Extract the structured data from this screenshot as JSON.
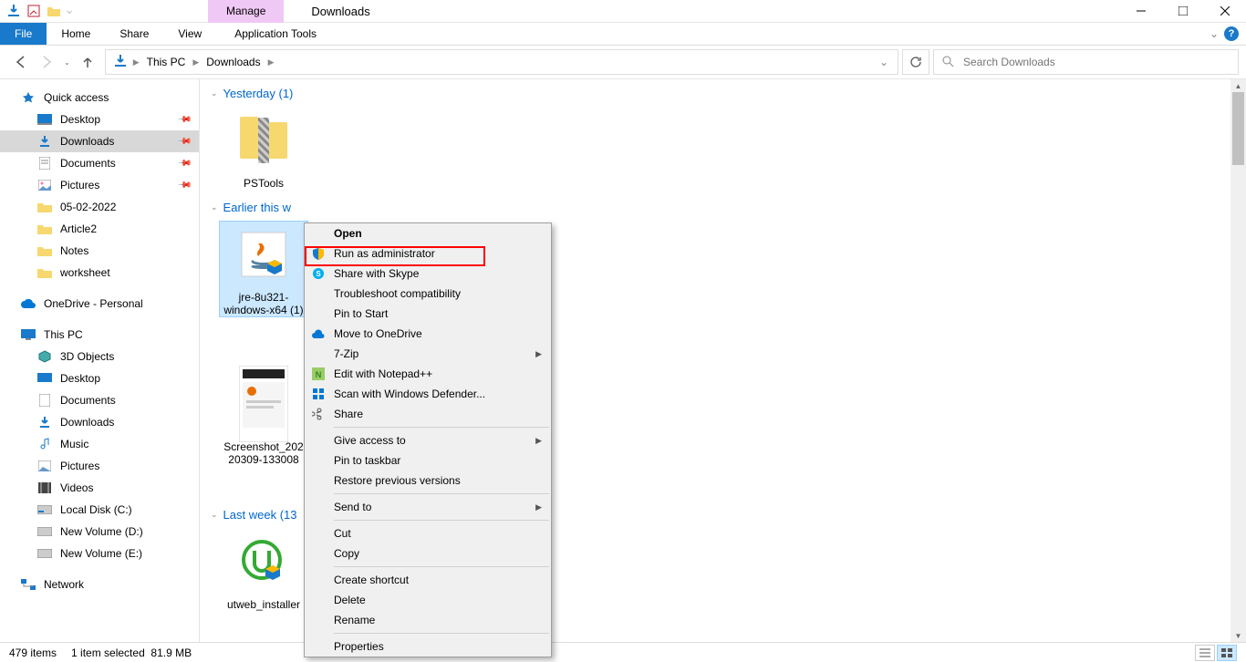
{
  "titlebar": {
    "contextual_tab": "Manage",
    "window_title": "Downloads"
  },
  "ribbon": {
    "file": "File",
    "home": "Home",
    "share": "Share",
    "view": "View",
    "app_tools": "Application Tools"
  },
  "breadcrumb": {
    "root": "This PC",
    "current": "Downloads"
  },
  "search": {
    "placeholder": "Search Downloads"
  },
  "sidebar": {
    "quick_access": "Quick access",
    "qa_items": [
      {
        "label": "Desktop",
        "icon": "desktop"
      },
      {
        "label": "Downloads",
        "icon": "downloads",
        "active": true
      },
      {
        "label": "Documents",
        "icon": "documents"
      },
      {
        "label": "Pictures",
        "icon": "pictures"
      },
      {
        "label": "05-02-2022",
        "icon": "folder"
      },
      {
        "label": "Article2",
        "icon": "folder"
      },
      {
        "label": "Notes",
        "icon": "folder"
      },
      {
        "label": "worksheet",
        "icon": "folder"
      }
    ],
    "onedrive": "OneDrive - Personal",
    "this_pc": "This PC",
    "pc_items": [
      {
        "label": "3D Objects"
      },
      {
        "label": "Desktop"
      },
      {
        "label": "Documents"
      },
      {
        "label": "Downloads"
      },
      {
        "label": "Music"
      },
      {
        "label": "Pictures"
      },
      {
        "label": "Videos"
      },
      {
        "label": "Local Disk (C:)"
      },
      {
        "label": "New Volume (D:)"
      },
      {
        "label": "New Volume (E:)"
      }
    ],
    "network": "Network"
  },
  "groups": {
    "yesterday": {
      "label": "Yesterday (1)",
      "items": [
        {
          "name": "PSTools",
          "type": "zipfolder"
        }
      ]
    },
    "earlier": {
      "label": "Earlier this w",
      "items": [
        {
          "name": "jre-8u321-windows-x64 (1)",
          "type": "exe-java",
          "selected": true
        },
        {
          "name": "Screenshot_20220309-133008",
          "type": "image"
        }
      ]
    },
    "lastweek": {
      "label": "Last week (13",
      "items": [
        {
          "name": "utweb_installer",
          "type": "exe-ut"
        }
      ]
    }
  },
  "context_menu": {
    "open": "Open",
    "run_admin": "Run as administrator",
    "share_skype": "Share with Skype",
    "troubleshoot": "Troubleshoot compatibility",
    "pin_start": "Pin to Start",
    "move_onedrive": "Move to OneDrive",
    "sevenzip": "7-Zip",
    "edit_np": "Edit with Notepad++",
    "defender": "Scan with Windows Defender...",
    "share": "Share",
    "give_access": "Give access to",
    "pin_taskbar": "Pin to taskbar",
    "restore": "Restore previous versions",
    "send_to": "Send to",
    "cut": "Cut",
    "copy": "Copy",
    "shortcut": "Create shortcut",
    "delete": "Delete",
    "rename": "Rename",
    "properties": "Properties"
  },
  "status": {
    "count": "479 items",
    "selected": "1 item selected",
    "size": "81.9 MB"
  },
  "colors": {
    "accent": "#1979ca",
    "selection": "#cce8ff",
    "contextual_tab": "#f0c8f5",
    "highlight_border": "#ff0000"
  }
}
